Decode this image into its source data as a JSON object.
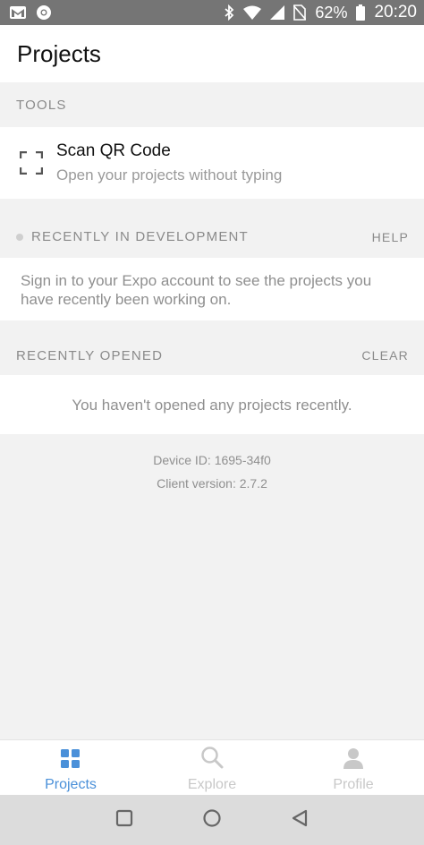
{
  "status_bar": {
    "battery": "62%",
    "time": "20:20"
  },
  "header": {
    "title": "Projects"
  },
  "tools": {
    "heading": "TOOLS",
    "scan_title": "Scan QR Code",
    "scan_subtitle": "Open your projects without typing"
  },
  "recent_dev": {
    "heading": "RECENTLY IN DEVELOPMENT",
    "action": "HELP",
    "message": "Sign in to your Expo account to see the projects you have recently been working on."
  },
  "recent_opened": {
    "heading": "RECENTLY OPENED",
    "action": "CLEAR",
    "message": "You haven't opened any projects recently."
  },
  "info": {
    "device_id": "Device ID: 1695-34f0",
    "client_version": "Client version: 2.7.2"
  },
  "tabs": [
    {
      "label": "Projects",
      "icon": "grid-icon",
      "active": true
    },
    {
      "label": "Explore",
      "icon": "search-icon",
      "active": false
    },
    {
      "label": "Profile",
      "icon": "person-icon",
      "active": false
    }
  ],
  "colors": {
    "accent": "#4a90d9",
    "inactive": "#c8c8c8",
    "status_bar": "#757575"
  }
}
